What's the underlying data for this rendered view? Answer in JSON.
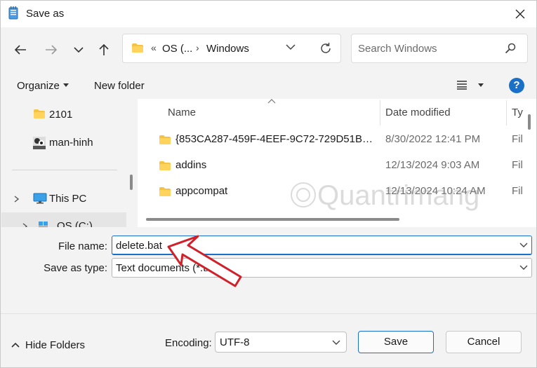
{
  "window": {
    "title": "Save as",
    "close_icon": "close-icon"
  },
  "nav": {
    "back_icon": "arrow-left-icon",
    "forward_icon": "arrow-right-icon",
    "recent_icon": "chevron-down-icon",
    "up_icon": "arrow-up-icon",
    "address": {
      "overflow": "«",
      "crumbs": [
        "OS (...",
        "Windows"
      ]
    },
    "search_placeholder": "Search Windows"
  },
  "toolbar": {
    "organize": "Organize",
    "new_folder": "New folder",
    "help": "?"
  },
  "tree": {
    "items": [
      {
        "label": "2101",
        "icon": "folder-icon"
      },
      {
        "label": "man-hinh",
        "icon": "image-thumbnail-icon"
      },
      {
        "label": "This PC",
        "icon": "computer-icon"
      },
      {
        "label": "OS (C:)",
        "icon": "drive-icon"
      }
    ]
  },
  "files": {
    "columns": [
      "Name",
      "Date modified",
      "Ty"
    ],
    "rows": [
      {
        "name": "{853CA287-459F-4EEF-9C72-729D51BA8...",
        "date": "8/30/2022 12:41 PM",
        "type": "Fil"
      },
      {
        "name": "addins",
        "date": "12/13/2024 9:03 AM",
        "type": "Fil"
      },
      {
        "name": "appcompat",
        "date": "12/13/2024 10:24 AM",
        "type": "Fil"
      }
    ]
  },
  "form": {
    "file_name_label": "File name:",
    "file_name_value": "delete.bat",
    "save_type_label": "Save as type:",
    "save_type_value": "Text documents (*.txt)"
  },
  "bottom": {
    "hide_folders": "Hide Folders",
    "encoding_label": "Encoding:",
    "encoding_value": "UTF-8",
    "save": "Save",
    "cancel": "Cancel"
  },
  "watermark": "Quantrimang",
  "colors": {
    "accent": "#1a6fc9",
    "annotation": "#d0202a",
    "folder": "#f5c242"
  }
}
